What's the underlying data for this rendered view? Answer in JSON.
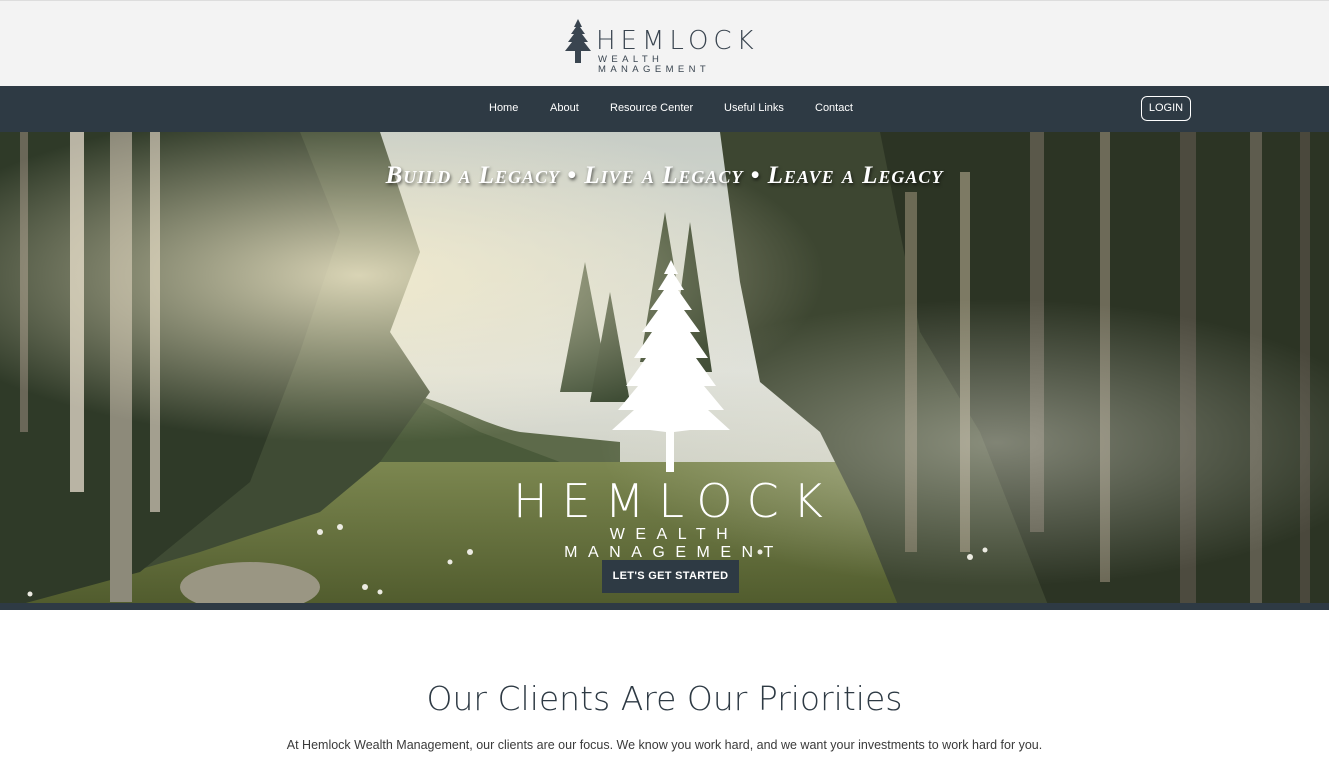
{
  "header": {
    "logo_name": "HEMLOCK",
    "logo_sub": "WEALTH MANAGEMENT"
  },
  "nav": {
    "items": [
      "Home",
      "About",
      "Resource Center",
      "Useful Links",
      "Contact"
    ],
    "login": "LOGIN"
  },
  "hero": {
    "tagline": "Build a Legacy  •  Live a Legacy  •  Leave a Legacy",
    "brand": "HEMLOCK",
    "brand_sub": "WEALTH MANAGEMENT",
    "cta": "LET'S GET STARTED"
  },
  "content": {
    "heading": "Our Clients Are Our Priorities",
    "text": "At Hemlock Wealth Management, our clients are our focus. We know you work hard, and we want your investments to work hard for you."
  },
  "colors": {
    "nav_bg": "#2e3a44",
    "topbar_bg": "#f3f3f3",
    "heading": "#2e3a44"
  }
}
